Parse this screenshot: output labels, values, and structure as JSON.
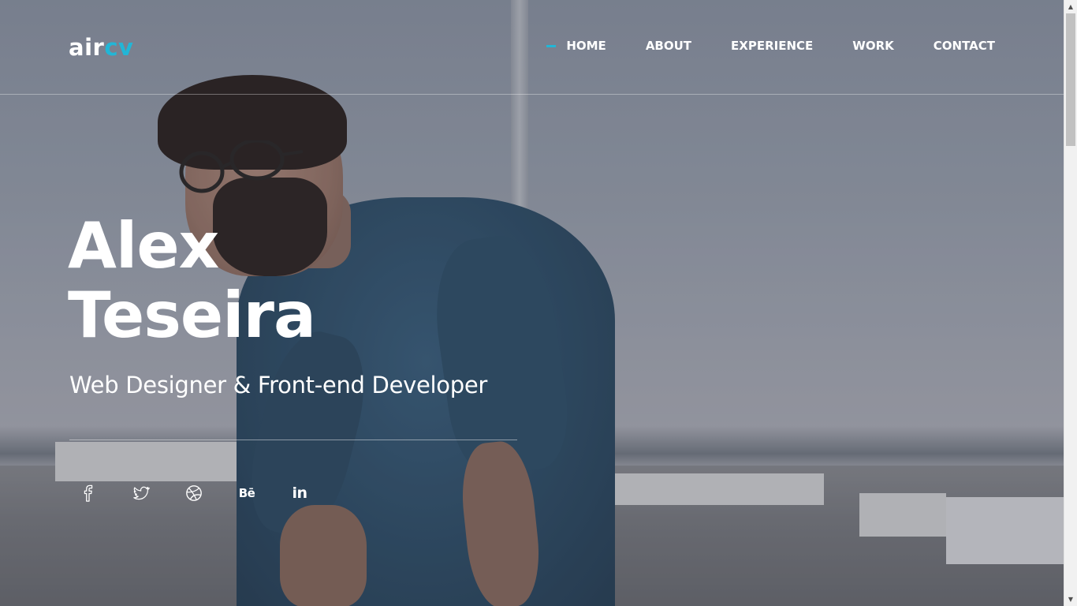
{
  "header": {
    "logo": {
      "part1": "air",
      "part2": "cv"
    },
    "nav": [
      {
        "label": "HOME",
        "active": true
      },
      {
        "label": "ABOUT",
        "active": false
      },
      {
        "label": "EXPERIENCE",
        "active": false
      },
      {
        "label": "WORK",
        "active": false
      },
      {
        "label": "CONTACT",
        "active": false
      }
    ]
  },
  "hero": {
    "first_name": "Alex",
    "last_name": "Teseira",
    "role": "Web Designer & Front-end Developer",
    "social": [
      {
        "icon": "facebook-icon"
      },
      {
        "icon": "twitter-icon"
      },
      {
        "icon": "dribbble-icon"
      },
      {
        "icon": "behance-icon",
        "label": "Bē"
      },
      {
        "icon": "linkedin-icon",
        "label": "in"
      }
    ]
  },
  "colors": {
    "accent": "#22b6d6",
    "text": "#ffffff"
  }
}
